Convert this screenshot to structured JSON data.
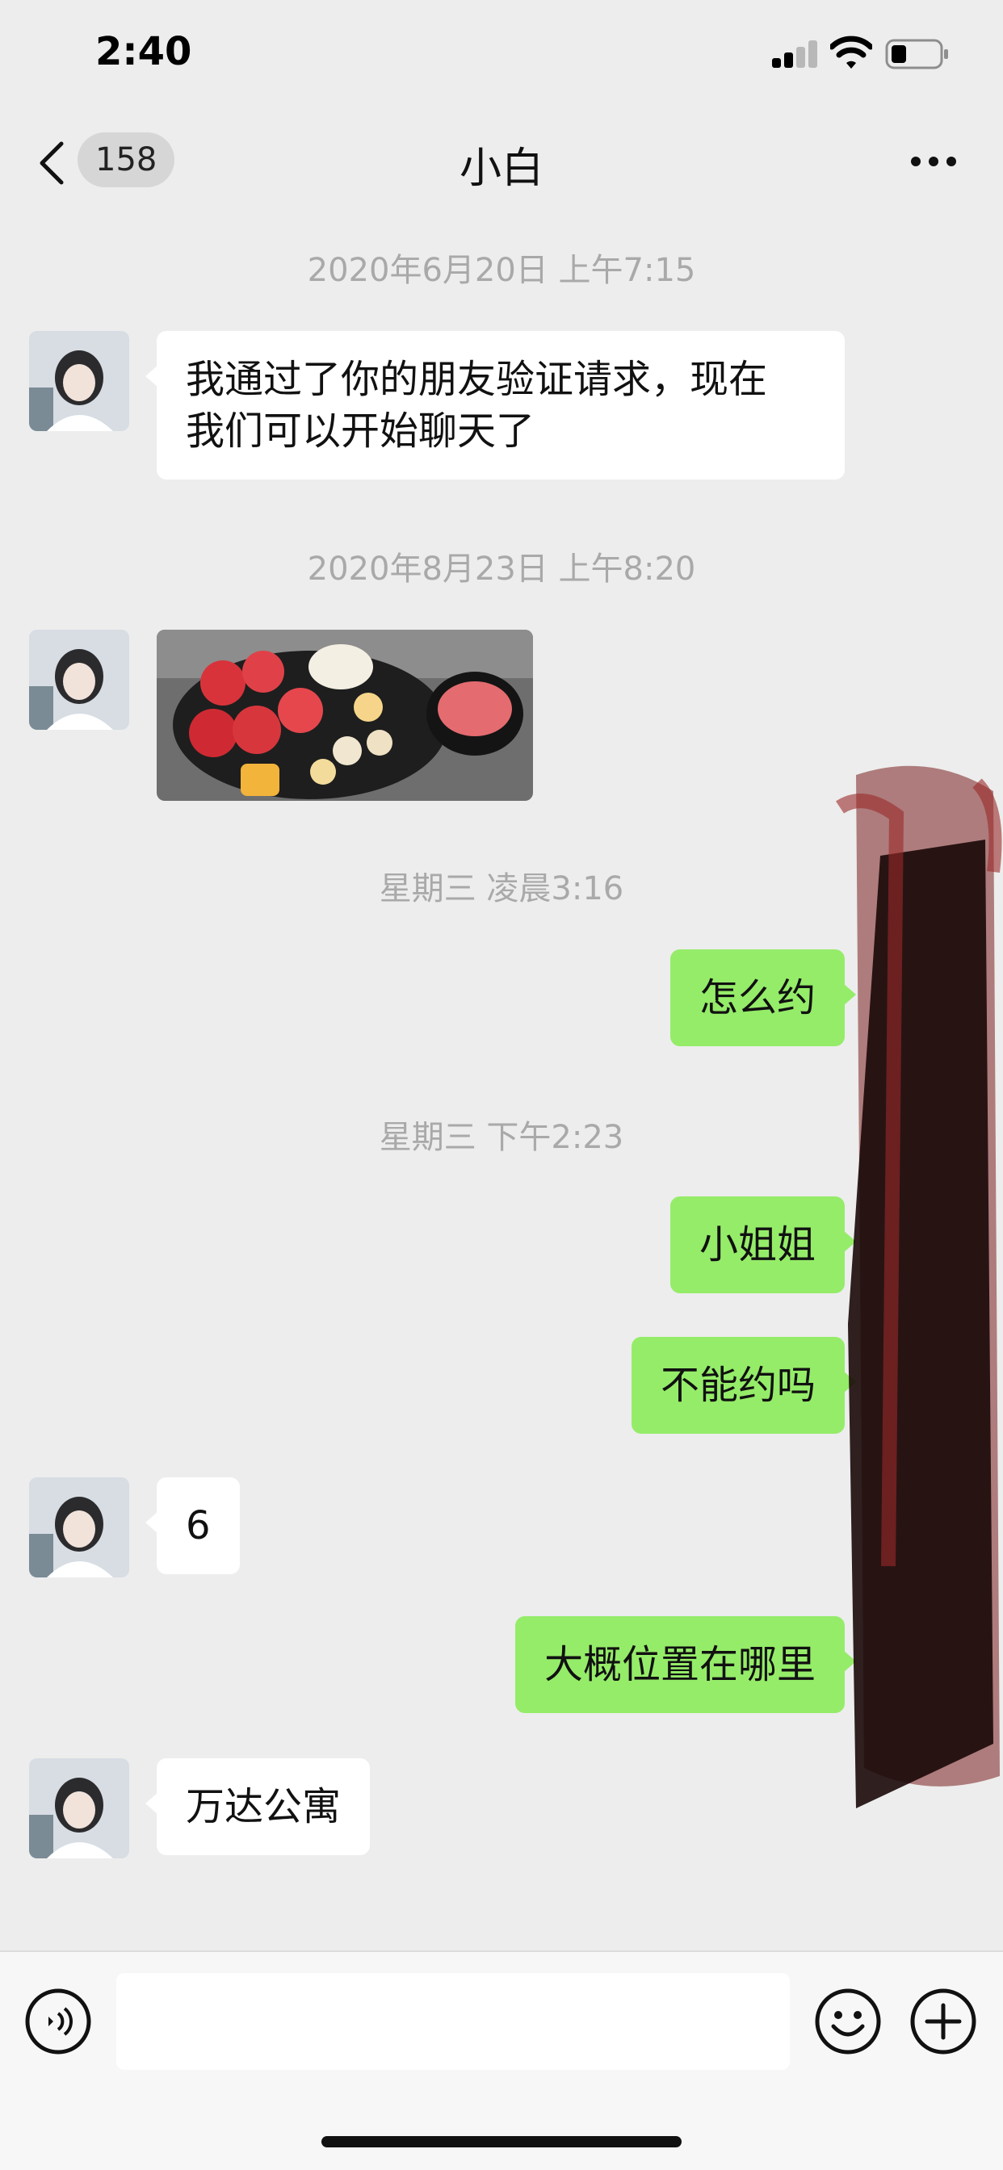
{
  "status_bar": {
    "time": "2:40"
  },
  "header": {
    "unread_count": "158",
    "title": "小白"
  },
  "messages": [
    {
      "kind": "timestamp",
      "text": "2020年6月20日 上午7:15"
    },
    {
      "kind": "incoming",
      "text_line1": "我通过了你的朋友验证请求，现在",
      "text_line2": "我们可以开始聊天了"
    },
    {
      "kind": "timestamp",
      "text": "2020年8月23日 上午8:20"
    },
    {
      "kind": "incoming-image"
    },
    {
      "kind": "timestamp",
      "text": "星期三 凌晨3:16"
    },
    {
      "kind": "outgoing",
      "text": "怎么约"
    },
    {
      "kind": "timestamp",
      "text": "星期三 下午2:23"
    },
    {
      "kind": "outgoing",
      "text": "小姐姐"
    },
    {
      "kind": "outgoing",
      "text": "不能约吗"
    },
    {
      "kind": "incoming",
      "text": "6"
    },
    {
      "kind": "outgoing",
      "text": "大概位置在哪里"
    },
    {
      "kind": "incoming",
      "text": "万达公寓"
    }
  ],
  "colors": {
    "background": "#ededed",
    "incoming_bubble": "#ffffff",
    "outgoing_bubble": "#95ec69",
    "timestamp_text": "#a9a9a9"
  },
  "icons": {
    "back": "chevron-left-icon",
    "more": "ellipsis-icon",
    "voice": "voice-icon",
    "emoji": "smiley-icon",
    "plus": "plus-icon"
  }
}
